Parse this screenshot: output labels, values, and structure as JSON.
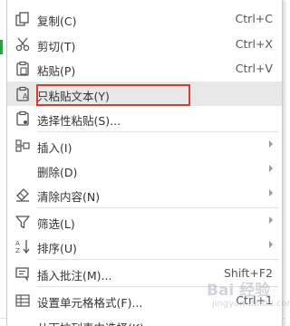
{
  "menu": {
    "items": [
      {
        "label": "复制(C)",
        "shortcut": "Ctrl+C",
        "icon": "copy-icon"
      },
      {
        "label": "剪切(T)",
        "shortcut": "Ctrl+X",
        "icon": "scissors-icon"
      },
      {
        "label": "粘贴(P)",
        "shortcut": "Ctrl+V",
        "icon": "paste-icon"
      },
      {
        "label": "只粘贴文本(Y)",
        "shortcut": "",
        "icon": "paste-text-icon"
      },
      {
        "label": "选择性粘贴(S)...",
        "shortcut": "",
        "icon": "paste-special-icon"
      },
      {
        "label": "插入(I)",
        "shortcut": "",
        "icon": "insert-icon"
      },
      {
        "label": "删除(D)",
        "shortcut": "",
        "icon": ""
      },
      {
        "label": "清除内容(N)",
        "shortcut": "",
        "icon": "eraser-icon"
      },
      {
        "label": "筛选(L)",
        "shortcut": "",
        "icon": "filter-icon"
      },
      {
        "label": "排序(U)",
        "shortcut": "",
        "icon": "sort-icon"
      },
      {
        "label": "插入批注(M)...",
        "shortcut": "Shift+F2",
        "icon": "comment-icon"
      },
      {
        "label": "设置单元格格式(F)...",
        "shortcut": "Ctrl+1",
        "icon": "format-cells-icon"
      },
      {
        "label": "从下拉列表中选择(K)...",
        "shortcut": "",
        "icon": ""
      }
    ]
  },
  "watermark": {
    "text": "Bai 经验",
    "sub": "jingyan.baidu.com"
  },
  "colors": {
    "highlight": "#e0392f",
    "hover_bg": "#e8e8e8",
    "accent_green": "#2f9e3e"
  }
}
